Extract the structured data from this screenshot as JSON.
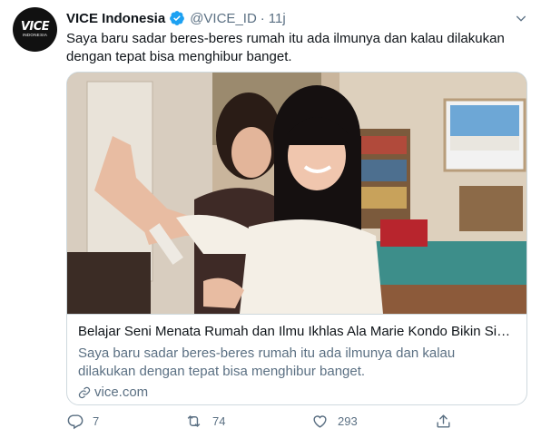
{
  "tweet": {
    "avatar": {
      "logo_main": "VICE",
      "logo_sub": "INDONESIA"
    },
    "author_name": "VICE Indonesia",
    "handle": "@VICE_ID",
    "separator": "·",
    "time": "11j",
    "text": "Saya baru sadar beres-beres rumah itu ada ilmunya dan kalau dilakukan dengan tepat bisa menghibur banget.",
    "card": {
      "title": "Belajar Seni Menata Rumah dan Ilmu Ikhlas Ala Marie Kondo Bikin Siapa...",
      "description": "Saya baru sadar beres-beres rumah itu ada ilmunya dan kalau dilakukan dengan tepat bisa menghibur banget.",
      "domain": "vice.com"
    },
    "actions": {
      "reply_count": "7",
      "retweet_count": "74",
      "like_count": "293"
    }
  },
  "colors": {
    "text_primary": "#0f1419",
    "text_secondary": "#5b7083",
    "verified_blue": "#1da1f2",
    "border": "#cfd9de"
  },
  "icons": [
    "verified-badge-icon",
    "chevron-down-icon",
    "link-icon",
    "reply-icon",
    "retweet-icon",
    "like-icon",
    "share-icon"
  ]
}
